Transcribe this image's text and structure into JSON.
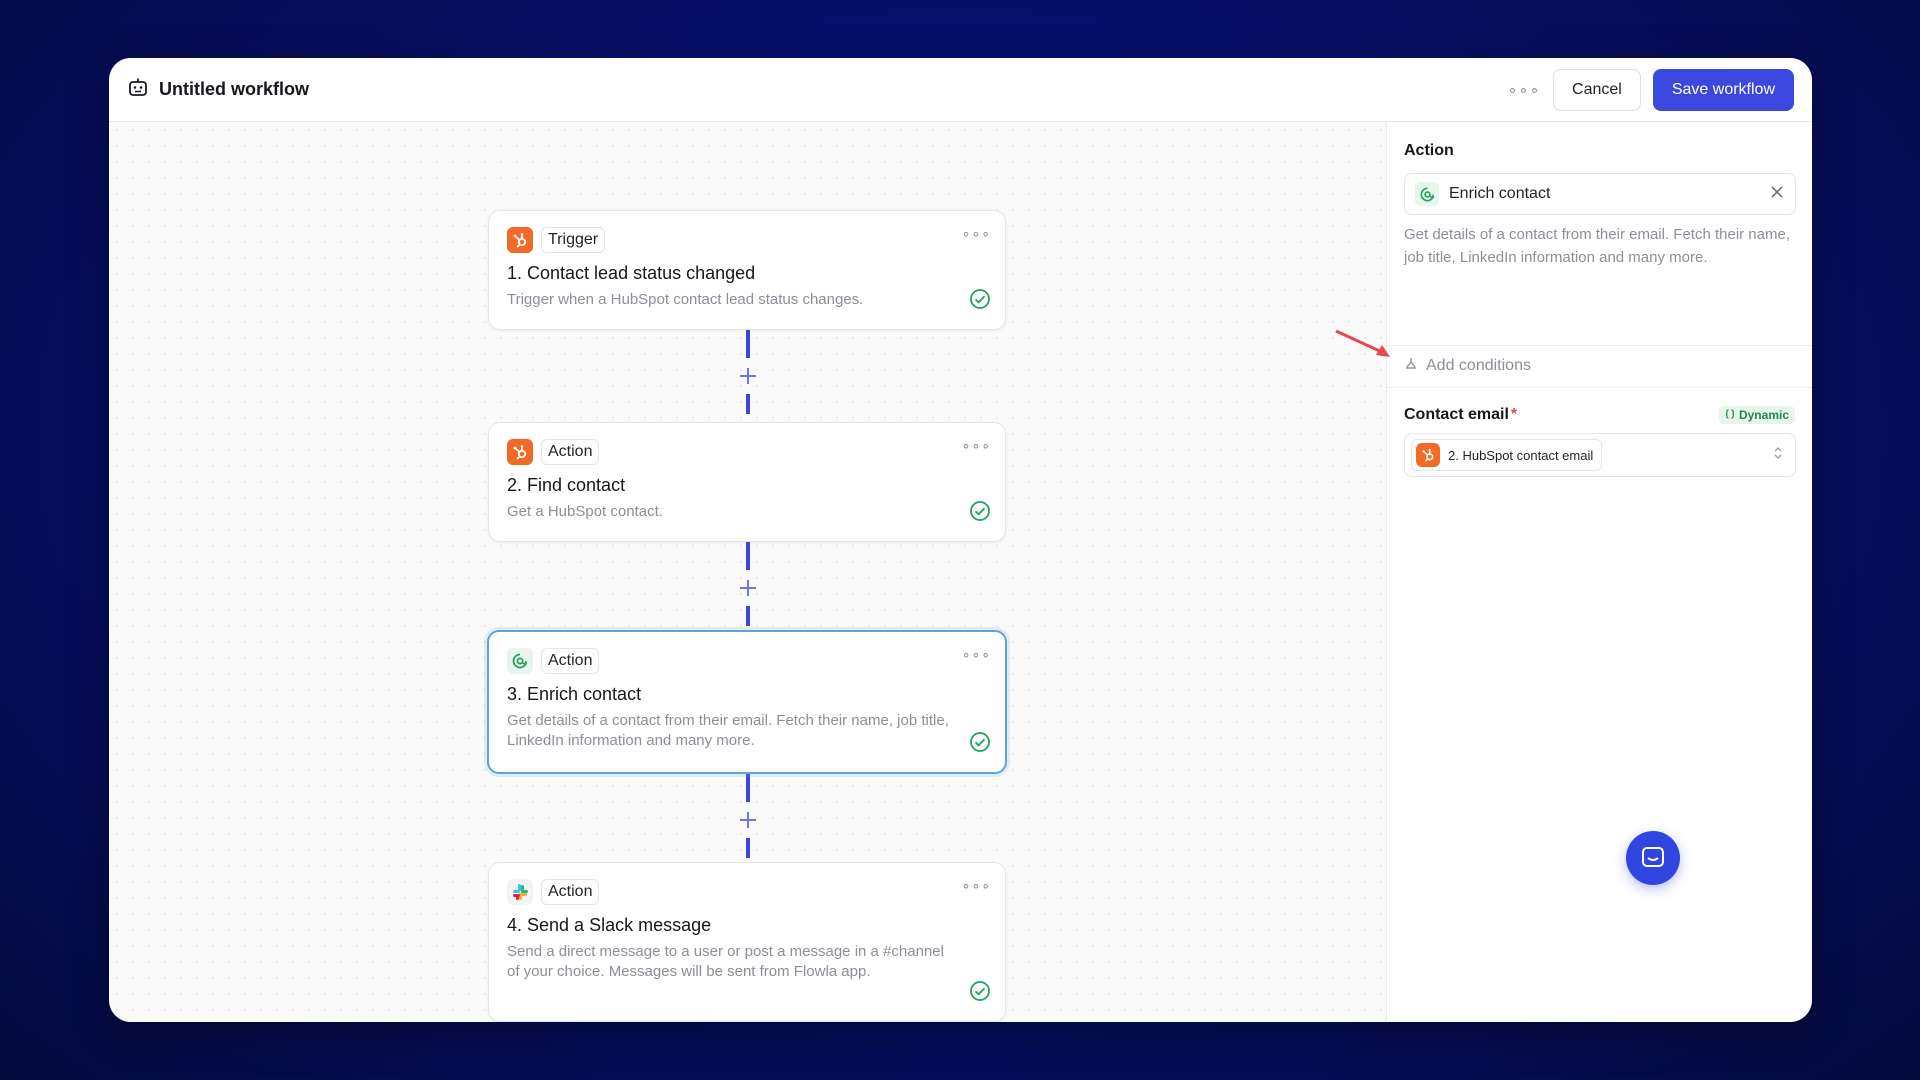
{
  "header": {
    "title": "Untitled workflow",
    "menu_glyph": "∘∘∘",
    "cancel_label": "Cancel",
    "save_label": "Save workflow"
  },
  "workflow": {
    "steps": [
      {
        "tag": "Trigger",
        "name": "1. Contact lead status changed",
        "description": "Trigger when a HubSpot contact lead status changes.",
        "icon": "hubspot-icon",
        "status": "valid"
      },
      {
        "tag": "Action",
        "name": "2. Find contact",
        "description": "Get a HubSpot contact.",
        "icon": "hubspot-icon",
        "status": "valid"
      },
      {
        "tag": "Action",
        "name": "3. Enrich contact",
        "description": "Get details of a contact from their email. Fetch their name, job title, LinkedIn information and many more.",
        "icon": "enrich-icon",
        "status": "valid",
        "selected": true
      },
      {
        "tag": "Action",
        "name": "4. Send a Slack message",
        "description": "Send a direct message to a user or post a message in a #channel of your choice. Messages will be sent from Flowla app.",
        "icon": "slack-icon",
        "status": "valid"
      }
    ],
    "menu_glyph": "∘∘∘"
  },
  "panel": {
    "section_label": "Action",
    "selected_action": "Enrich contact",
    "help_text": "Get details of a contact from their email. Fetch their name, job title, LinkedIn information and many more.",
    "add_conditions_label": "Add conditions",
    "field": {
      "label": "Contact email",
      "required_marker": "*",
      "dynamic_badge": "Dynamic",
      "value": "2. HubSpot contact email"
    }
  },
  "colors": {
    "accent": "#3a48e0",
    "hubspot": "#f26a26",
    "success": "#22a35a",
    "selected_border": "#5da4d8",
    "annotation_arrow": "#e5484d"
  }
}
